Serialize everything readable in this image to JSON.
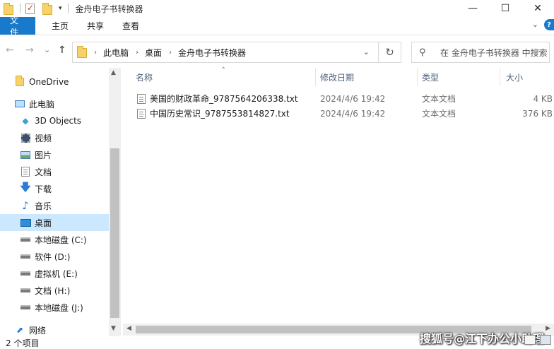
{
  "window": {
    "title": "金舟电子书转换器",
    "controls": {
      "minimize": "—",
      "maximize": "☐",
      "close": "✕"
    }
  },
  "ribbon": {
    "tabs": [
      "文件",
      "主页",
      "共享",
      "查看"
    ],
    "collapse_icon": "chevron-down-icon",
    "help_icon": "?"
  },
  "nav": {
    "back": "←",
    "forward": "→",
    "recent": "⌄",
    "up": "↑",
    "breadcrumb": [
      "此电脑",
      "桌面",
      "金舟电子书转换器"
    ],
    "dropdown": "⌄",
    "refresh": "↻",
    "search_placeholder": "在 金舟电子书转换器 中搜索"
  },
  "sidebar": {
    "items": [
      {
        "label": "OneDrive",
        "icon": "folder-icon"
      },
      {
        "label": "此电脑",
        "icon": "computer-icon"
      },
      {
        "label": "3D Objects",
        "icon": "cube-icon"
      },
      {
        "label": "视频",
        "icon": "video-icon"
      },
      {
        "label": "图片",
        "icon": "picture-icon"
      },
      {
        "label": "文档",
        "icon": "document-icon"
      },
      {
        "label": "下载",
        "icon": "download-icon"
      },
      {
        "label": "音乐",
        "icon": "music-icon"
      },
      {
        "label": "桌面",
        "icon": "desktop-icon",
        "selected": true
      },
      {
        "label": "本地磁盘 (C:)",
        "icon": "drive-icon"
      },
      {
        "label": "软件 (D:)",
        "icon": "drive-icon"
      },
      {
        "label": "虚拟机 (E:)",
        "icon": "drive-icon"
      },
      {
        "label": "文档 (H:)",
        "icon": "drive-icon"
      },
      {
        "label": "本地磁盘 (J:)",
        "icon": "drive-icon"
      },
      {
        "label": "网络",
        "icon": "network-icon"
      }
    ]
  },
  "file_list": {
    "columns": {
      "name": "名称",
      "modified": "修改日期",
      "type": "类型",
      "size": "大小"
    },
    "rows": [
      {
        "name": "美国的财政革命_9787564206338.txt",
        "modified": "2024/4/6 19:42",
        "type": "文本文档",
        "size": "4 KB"
      },
      {
        "name": "中国历史常识_9787553814827.txt",
        "modified": "2024/4/6 19:42",
        "type": "文本文档",
        "size": "376 KB"
      }
    ]
  },
  "status": {
    "item_count": "2 个项目"
  },
  "watermark": "搜狐号@江下办公小助理"
}
